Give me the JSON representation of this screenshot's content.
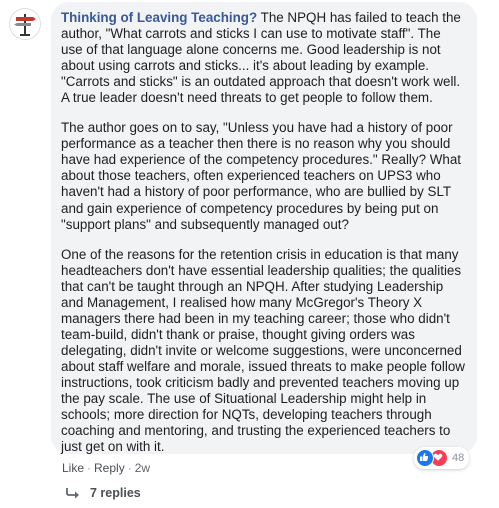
{
  "comment": {
    "author": "Thinking of Leaving Teaching?",
    "paragraph_1": "The NPQH has failed to teach the author, \"What carrots and sticks I can use to motivate staff\". The use of that language alone concerns me. Good leadership is not about using carrots and sticks... it's about leading by example. \"Carrots and sticks\" is an outdated approach that doesn't work well. A true leader doesn't need threats to get people to follow them.",
    "paragraph_2": "The author goes on to say, \"Unless you have had a history of poor performance as a teacher then there is no reason why you should have had experience of the competency procedures.\" Really? What about those teachers, often experienced teachers on UPS3 who haven't had a history of poor performance, who are bullied by SLT and gain experience of competency procedures by being put on \"support plans\" and subsequently managed out?",
    "paragraph_3": "One of the reasons for the retention crisis in education is that many headteachers don't have essential leadership qualities; the qualities that can't be taught through an NPQH. After studying Leadership and Management, I realised how many McGregor's Theory X managers there had been in my teaching career; those who didn't team-build, didn't thank or praise, thought giving orders was delegating, didn't invite or welcome suggestions, were unconcerned about staff welfare and morale, issued threats to make people follow instructions, took criticism badly and prevented teachers moving up the pay scale. The use of Situational Leadership might help in schools; more direction for NQTs, developing teachers through coaching and mentoring, and trusting the experienced teachers to just get on with it."
  },
  "actions": {
    "like": "Like",
    "separator": "·",
    "reply": "Reply",
    "time": "2w"
  },
  "reactions": {
    "icons": [
      "like-icon",
      "love-icon"
    ],
    "count": "48"
  },
  "replies": {
    "label": "7 replies",
    "icon": "reply-arrow-icon"
  },
  "colors": {
    "bubble": "#f2f3f5",
    "author": "#385898",
    "like": "#1877f2",
    "love": "#f33e58"
  }
}
